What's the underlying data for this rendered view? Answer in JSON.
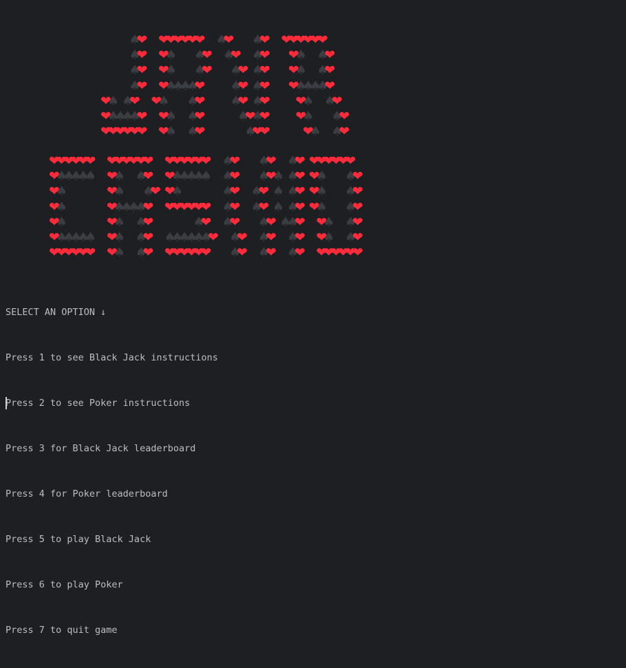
{
  "terminal": {
    "prompt_title": "SELECT AN OPTION",
    "prompt_icon": "down-arrow-icon",
    "prompt_arrow": "↓",
    "options": [
      "Press 1 to see Black Jack instructions",
      "Press 2 to see Poker instructions",
      "Press 3 for Black Jack leaderboard",
      "Press 4 for Poker leaderboard",
      "Press 5 to play Black Jack",
      "Press 6 to play Poker",
      "Press 7 to quit game"
    ]
  },
  "banner": {
    "words": [
      "JAVA",
      "CASINO"
    ],
    "glyph_heart": "❤",
    "glyph_spade": "♠",
    "heart_color": "#ff2b3a",
    "spade_color": "#3a3d42",
    "rows_java": [
      "              sh  hhhhhh  sh   sh  hhhhhh",
      "              sh  hs   sh  sh  sh   hs  sh",
      "              sh  hs   sh   sh sh   hs  sh",
      "              sh  hssssh    sh sh   hssssh",
      "          hs sh  hs   sh    sh sh    hs  sh",
      "          hssssh  hs  sh     shsh    hs   sh",
      "          hhhhhh  hs  sh      shh     hs  sh"
    ],
    "rows_casino": [
      "hhhhhh  hhhhhh  hhhhhh  sh   sh  sh hhhhhh",
      "hsssss  hs  sh  hsssss  sh   shs sh hs   sh",
      "hs      hs   sh hs      sh  sh s sh hs   sh",
      "hs      hssssh  hhhhhh  sh  sh s sh hs   sh",
      "hs      hs  sh      sh  sh   sh ssh  hs  sh",
      "hsssss  hs  sh  ssssssh  sh  sh  sh  hs  sh",
      "hhhhhh  hs  sh  hhhhhh   sh  sh  sh  hhhhhh"
    ]
  },
  "cursor_visible": true
}
